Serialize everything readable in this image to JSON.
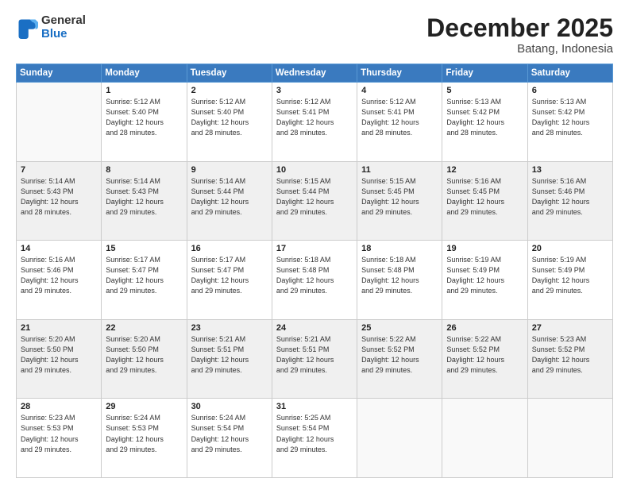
{
  "header": {
    "logo_general": "General",
    "logo_blue": "Blue",
    "month_title": "December 2025",
    "location": "Batang, Indonesia"
  },
  "days_of_week": [
    "Sunday",
    "Monday",
    "Tuesday",
    "Wednesday",
    "Thursday",
    "Friday",
    "Saturday"
  ],
  "weeks": [
    [
      {
        "day": "",
        "info": ""
      },
      {
        "day": "1",
        "info": "Sunrise: 5:12 AM\nSunset: 5:40 PM\nDaylight: 12 hours\nand 28 minutes."
      },
      {
        "day": "2",
        "info": "Sunrise: 5:12 AM\nSunset: 5:40 PM\nDaylight: 12 hours\nand 28 minutes."
      },
      {
        "day": "3",
        "info": "Sunrise: 5:12 AM\nSunset: 5:41 PM\nDaylight: 12 hours\nand 28 minutes."
      },
      {
        "day": "4",
        "info": "Sunrise: 5:12 AM\nSunset: 5:41 PM\nDaylight: 12 hours\nand 28 minutes."
      },
      {
        "day": "5",
        "info": "Sunrise: 5:13 AM\nSunset: 5:42 PM\nDaylight: 12 hours\nand 28 minutes."
      },
      {
        "day": "6",
        "info": "Sunrise: 5:13 AM\nSunset: 5:42 PM\nDaylight: 12 hours\nand 28 minutes."
      }
    ],
    [
      {
        "day": "7",
        "info": ""
      },
      {
        "day": "8",
        "info": "Sunrise: 5:14 AM\nSunset: 5:43 PM\nDaylight: 12 hours\nand 29 minutes."
      },
      {
        "day": "9",
        "info": "Sunrise: 5:14 AM\nSunset: 5:44 PM\nDaylight: 12 hours\nand 29 minutes."
      },
      {
        "day": "10",
        "info": "Sunrise: 5:15 AM\nSunset: 5:44 PM\nDaylight: 12 hours\nand 29 minutes."
      },
      {
        "day": "11",
        "info": "Sunrise: 5:15 AM\nSunset: 5:45 PM\nDaylight: 12 hours\nand 29 minutes."
      },
      {
        "day": "12",
        "info": "Sunrise: 5:16 AM\nSunset: 5:45 PM\nDaylight: 12 hours\nand 29 minutes."
      },
      {
        "day": "13",
        "info": "Sunrise: 5:16 AM\nSunset: 5:46 PM\nDaylight: 12 hours\nand 29 minutes."
      }
    ],
    [
      {
        "day": "14",
        "info": ""
      },
      {
        "day": "15",
        "info": "Sunrise: 5:17 AM\nSunset: 5:47 PM\nDaylight: 12 hours\nand 29 minutes."
      },
      {
        "day": "16",
        "info": "Sunrise: 5:17 AM\nSunset: 5:47 PM\nDaylight: 12 hours\nand 29 minutes."
      },
      {
        "day": "17",
        "info": "Sunrise: 5:18 AM\nSunset: 5:48 PM\nDaylight: 12 hours\nand 29 minutes."
      },
      {
        "day": "18",
        "info": "Sunrise: 5:18 AM\nSunset: 5:48 PM\nDaylight: 12 hours\nand 29 minutes."
      },
      {
        "day": "19",
        "info": "Sunrise: 5:19 AM\nSunset: 5:49 PM\nDaylight: 12 hours\nand 29 minutes."
      },
      {
        "day": "20",
        "info": "Sunrise: 5:19 AM\nSunset: 5:49 PM\nDaylight: 12 hours\nand 29 minutes."
      }
    ],
    [
      {
        "day": "21",
        "info": ""
      },
      {
        "day": "22",
        "info": "Sunrise: 5:20 AM\nSunset: 5:50 PM\nDaylight: 12 hours\nand 29 minutes."
      },
      {
        "day": "23",
        "info": "Sunrise: 5:21 AM\nSunset: 5:51 PM\nDaylight: 12 hours\nand 29 minutes."
      },
      {
        "day": "24",
        "info": "Sunrise: 5:21 AM\nSunset: 5:51 PM\nDaylight: 12 hours\nand 29 minutes."
      },
      {
        "day": "25",
        "info": "Sunrise: 5:22 AM\nSunset: 5:52 PM\nDaylight: 12 hours\nand 29 minutes."
      },
      {
        "day": "26",
        "info": "Sunrise: 5:22 AM\nSunset: 5:52 PM\nDaylight: 12 hours\nand 29 minutes."
      },
      {
        "day": "27",
        "info": "Sunrise: 5:23 AM\nSunset: 5:52 PM\nDaylight: 12 hours\nand 29 minutes."
      }
    ],
    [
      {
        "day": "28",
        "info": ""
      },
      {
        "day": "29",
        "info": "Sunrise: 5:24 AM\nSunset: 5:53 PM\nDaylight: 12 hours\nand 29 minutes."
      },
      {
        "day": "30",
        "info": "Sunrise: 5:24 AM\nSunset: 5:54 PM\nDaylight: 12 hours\nand 29 minutes."
      },
      {
        "day": "31",
        "info": "Sunrise: 5:25 AM\nSunset: 5:54 PM\nDaylight: 12 hours\nand 29 minutes."
      },
      {
        "day": "",
        "info": ""
      },
      {
        "day": "",
        "info": ""
      },
      {
        "day": "",
        "info": ""
      }
    ]
  ],
  "week1_day7_info": "Sunrise: 5:14 AM\nSunset: 5:43 PM\nDaylight: 12 hours\nand 28 minutes.",
  "week3_day14_info": "Sunrise: 5:16 AM\nSunset: 5:46 PM\nDaylight: 12 hours\nand 29 minutes.",
  "week4_day21_info": "Sunrise: 5:20 AM\nSunset: 5:50 PM\nDaylight: 12 hours\nand 29 minutes.",
  "week5_day28_info": "Sunrise: 5:23 AM\nSunset: 5:53 PM\nDaylight: 12 hours\nand 29 minutes."
}
